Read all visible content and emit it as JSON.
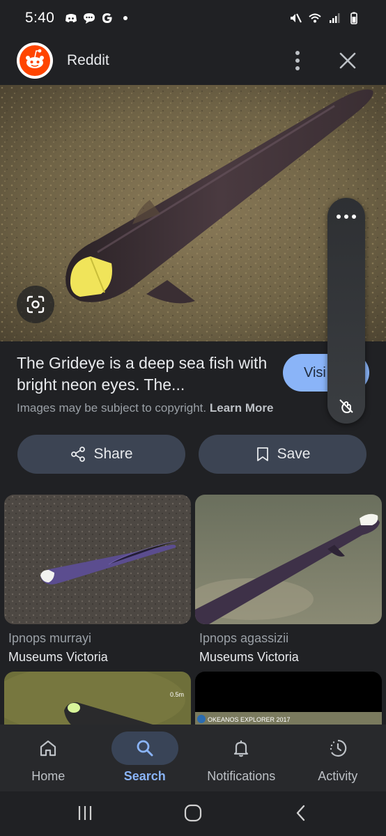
{
  "status_bar": {
    "time": "5:40"
  },
  "header": {
    "title": "Reddit"
  },
  "result": {
    "title": "The Gridеye is a deep sea fish with bright neon eyes. The...",
    "copyright_text": "Images may be subject to copyright.",
    "learn_more": "Learn More",
    "visit_label": "Visi"
  },
  "actions": {
    "share_label": "Share",
    "save_label": "Save"
  },
  "related": [
    {
      "title": "Ipnops murrayi",
      "source": "Museums Victoria"
    },
    {
      "title": "Ipnops agassizii",
      "source": "Museums Victoria"
    }
  ],
  "partial_thumbs": {
    "right_overlay": "OKEANOS EXPLORER 2017",
    "left_overlay": "0.5m"
  },
  "bottom_nav": [
    {
      "label": "Home",
      "icon": "home-icon",
      "active": false
    },
    {
      "label": "Search",
      "icon": "search-icon",
      "active": true
    },
    {
      "label": "Notifications",
      "icon": "bell-icon",
      "active": false
    },
    {
      "label": "Activity",
      "icon": "activity-icon",
      "active": false
    }
  ],
  "colors": {
    "accent": "#8ab4f8",
    "background": "#202124",
    "button": "#3c4453",
    "reddit": "#ff4500"
  }
}
